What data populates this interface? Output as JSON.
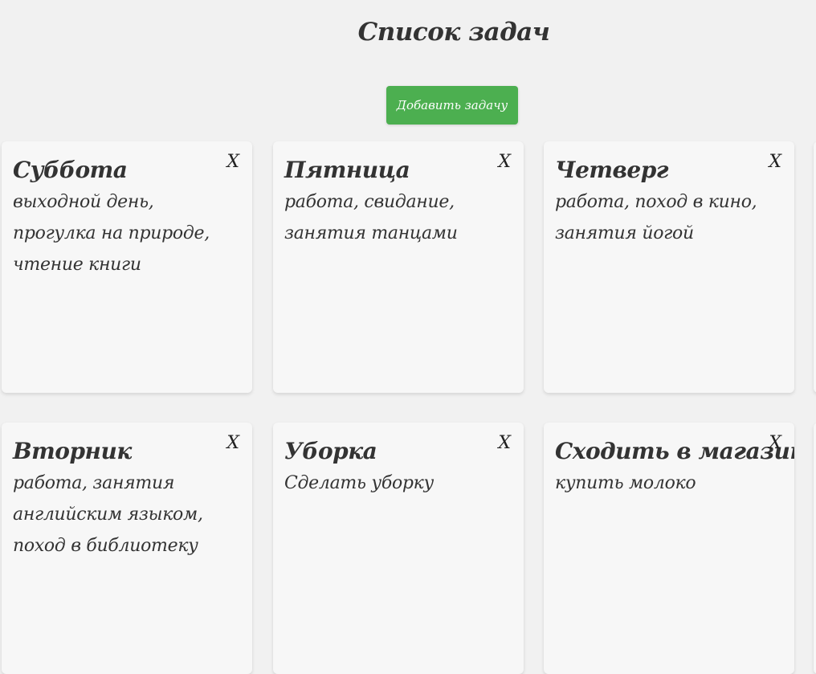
{
  "header": {
    "title": "Список задач",
    "add_button_label": "Добавить задачу"
  },
  "colors": {
    "accent": "#4caf50",
    "background": "#f1f1f1",
    "card": "#f7f7f7",
    "text": "#333333"
  },
  "cards": [
    {
      "title": "Суббота",
      "text": "выходной день, прогулка на природе, чтение книги",
      "close_label": "X"
    },
    {
      "title": "Пятница",
      "text": "работа, свидание, занятия танцами",
      "close_label": "X"
    },
    {
      "title": "Четверг",
      "text": "работа, поход в кино, занятия йогой",
      "close_label": "X"
    },
    {
      "title": "Вторник",
      "text": "работа, занятия английским языком, поход в библиотеку",
      "close_label": "X"
    },
    {
      "title": "Уборка",
      "text": "Сделать уборку",
      "close_label": "X"
    },
    {
      "title": "Сходить в магазин",
      "text": "купить молоко",
      "close_label": "X"
    }
  ]
}
